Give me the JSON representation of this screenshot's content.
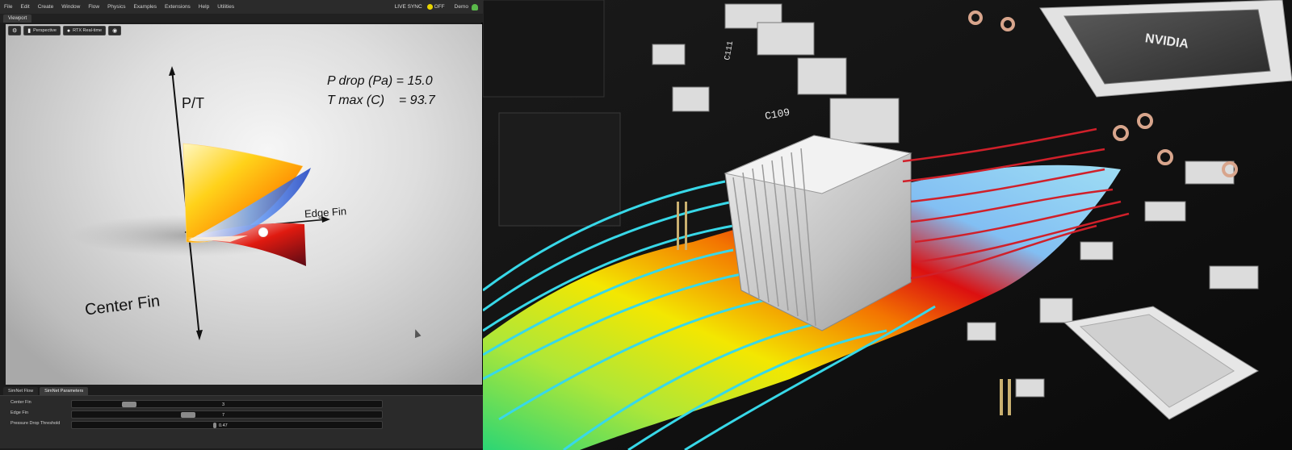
{
  "menubar": {
    "items": [
      "File",
      "Edit",
      "Create",
      "Window",
      "Flow",
      "Physics",
      "Examples",
      "Extensions",
      "Help",
      "Utilities"
    ],
    "live_sync": "LIVE SYNC",
    "sync_state": "OFF",
    "user": "Demo"
  },
  "viewport": {
    "tab": "Viewport",
    "toolbar": {
      "camera": "Perspective",
      "renderer": "RTX Real-time"
    },
    "readouts": {
      "pressure_drop": "P drop (Pa) = 15.0",
      "temperature_max": "T max (C)    = 93.7"
    },
    "axes": {
      "vertical": "P/T",
      "diagonal": "Edge Fin",
      "horizontal": "Center Fin"
    }
  },
  "panel": {
    "tabs": [
      "SimNet Flow",
      "SimNet Parameters"
    ],
    "params": [
      {
        "label": "Center Fin",
        "value": "3",
        "position": 0.17
      },
      {
        "label": "Edge Fin",
        "value": "7",
        "position": 0.37
      },
      {
        "label": "Pressure Drop Threshold",
        "value": "0.47",
        "position": 0.46
      }
    ]
  },
  "render": {
    "chip_brand": "NVIDIA",
    "silkscreen_labels": [
      "C109",
      "C111"
    ],
    "colors": {
      "cold_streamline": "#38d8e8",
      "hot_streamline": "#d0202a",
      "heatsink": "#c8c8c8"
    }
  }
}
